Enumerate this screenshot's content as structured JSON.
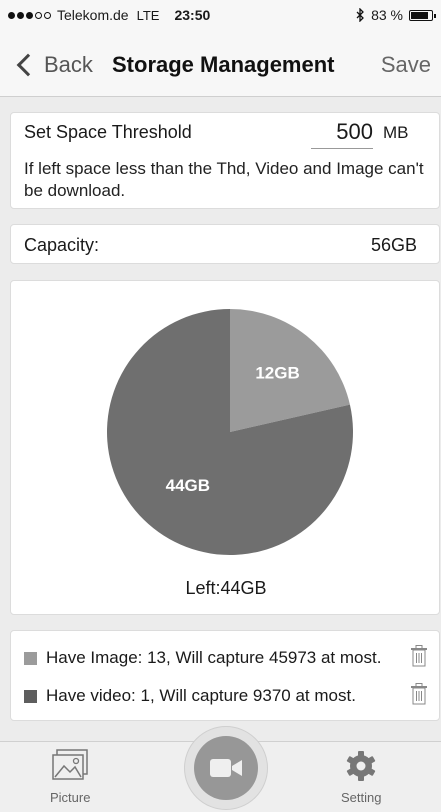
{
  "status_bar": {
    "carrier": "Telekom.de",
    "network": "LTE",
    "time": "23:50",
    "bluetooth_icon": "bluetooth-icon",
    "battery": "83 %",
    "battery_level": 0.83
  },
  "nav": {
    "back_label": "Back",
    "title": "Storage Management",
    "save_label": "Save"
  },
  "threshold": {
    "label": "Set Space Threshold",
    "value": "500",
    "unit": "MB",
    "note": "If left space less than the Thd, Video and Image can't be download."
  },
  "capacity": {
    "label": "Capacity:",
    "value": "56GB"
  },
  "chart_data": {
    "type": "pie",
    "slices": [
      {
        "label": "12GB",
        "value": 12,
        "color": "#9b9b9b"
      },
      {
        "label": "44GB",
        "value": 44,
        "color": "#6f6f6f"
      }
    ],
    "caption": "Left:44GB"
  },
  "legend": {
    "image_text": "Have Image: 13, Will capture 45973 at most.",
    "image_color": "#9b9b9b",
    "video_text": "Have video: 1, Will capture 9370 at most.",
    "video_color": "#5e5e5e"
  },
  "tab_bar": {
    "picture_label": "Picture",
    "setting_label": "Setting",
    "icons": [
      "picture-icon",
      "video-camera-icon",
      "gear-icon"
    ]
  },
  "colors": {
    "background": "#ececec",
    "bar": "#f7f7f7",
    "accent_gray": "#979797"
  }
}
